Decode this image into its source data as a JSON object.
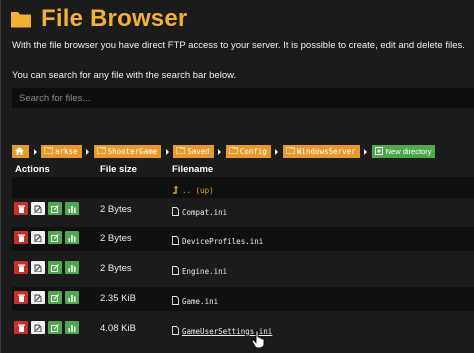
{
  "header": {
    "title": "File Browser",
    "folder_icon": "folder-icon",
    "accent": "#f2b134"
  },
  "intro_text": "With the file browser you have direct FTP access to your server. It is possible to create, edit and delete files.",
  "search": {
    "hint": "You can search for any file with the search bar below.",
    "placeholder": "Search for files...",
    "value": ""
  },
  "breadcrumb": {
    "home_icon": "home-icon",
    "items": [
      "arkse",
      "ShooterGame",
      "Saved",
      "Config",
      "WindowsServer"
    ],
    "new_directory_label": "New directory"
  },
  "table": {
    "columns": [
      "Actions",
      "File size",
      "Filename"
    ],
    "up_label": ".. (up)",
    "rows": [
      {
        "size": "2 Bytes",
        "name": "Compat.ini"
      },
      {
        "size": "2 Bytes",
        "name": "DeviceProfiles.ini"
      },
      {
        "size": "2 Bytes",
        "name": "Engine.ini"
      },
      {
        "size": "2.35 KiB",
        "name": "Game.ini"
      },
      {
        "size": "4.08 KiB",
        "name": "GameUserSettings.ini"
      }
    ],
    "action_icons": [
      "trash-icon",
      "edit-file-icon",
      "rename-icon",
      "download-icon"
    ]
  },
  "colors": {
    "orange": "#e69a2b",
    "green": "#4fa84f",
    "red": "#c8302c",
    "background": "#1b1b1b"
  }
}
